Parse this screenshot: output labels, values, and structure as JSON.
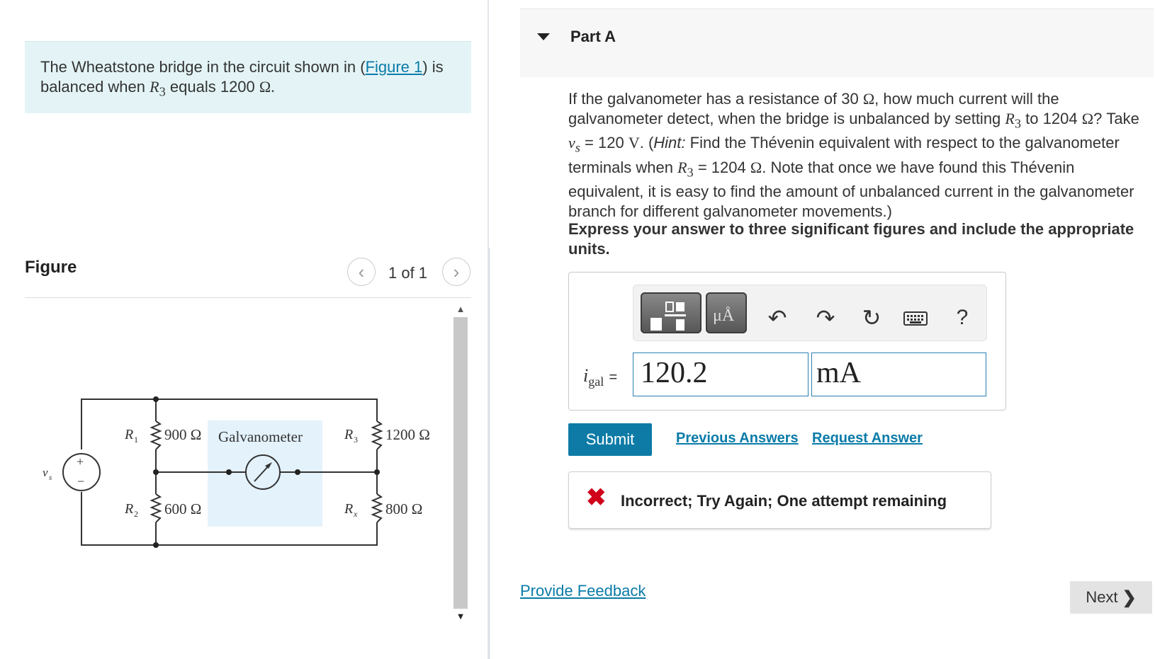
{
  "intro": {
    "text_before_link": "The Wheatstone bridge in the circuit shown in (",
    "link": "Figure 1",
    "text_after_link": ") is balanced when",
    "r3_symbol": "R",
    "r3_sub": "3",
    "text_equals": "equals 1200",
    "ohm": "Ω."
  },
  "figure": {
    "heading": "Figure",
    "counter": "1 of 1",
    "prev_icon": "‹",
    "next_icon": "›",
    "circuit": {
      "source_label": "v",
      "source_sub": "s",
      "plus": "+",
      "minus": "−",
      "r1_label": "R",
      "r1_sub": "1",
      "r1_value": "900 Ω",
      "r2_label": "R",
      "r2_sub": "2",
      "r2_value": "600 Ω",
      "r3_label": "R",
      "r3_sub": "3",
      "r3_value": "1200 Ω",
      "rx_label": "R",
      "rx_sub": "x",
      "rx_value": "800 Ω",
      "galvanometer": "Galvanometer"
    }
  },
  "part": {
    "title": "Part A",
    "question": {
      "p1": "If the galvanometer has a resistance of 30",
      "ohm": "Ω",
      "p2": ", how much current will the galvanometer detect, when the bridge is unbalanced by setting",
      "r3": "R",
      "r3_sub": "3",
      "p3": "to 1204",
      "ohm2": "Ω",
      "p4": "? Take",
      "vs": "v",
      "vs_sub": "s",
      "p5": "= 120",
      "volt": "V",
      "p6": ". (",
      "hint": "Hint:",
      "p7": "Find the Thévenin  equivalent with respect to the galvanometer terminals when",
      "r3b": "R",
      "r3b_sub": "3",
      "p8": "= 1204",
      "ohm3": "Ω",
      "p9": ". Note that once we have found this Thévenin equivalent, it is easy to find the amount of unbalanced current in the galvanometer branch for different galvanometer movements.)"
    },
    "instructions": "Express your answer to three significant figures and include the appropriate units.",
    "answer": {
      "label": "i",
      "label_sub": "gal",
      "equals": "=",
      "value": "120.2",
      "units": "mA"
    },
    "toolbar": {
      "units_glyph": "μÅ",
      "undo": "↶",
      "redo": "↷",
      "reset": "↻",
      "help": "?"
    },
    "submit": "Submit",
    "previous_answers": "Previous Answers",
    "request_answer": "Request Answer",
    "feedback": {
      "mark": "✖",
      "text": "Incorrect; Try Again; One attempt remaining"
    }
  },
  "footer": {
    "provide_feedback": "Provide Feedback",
    "next": "Next",
    "next_icon": "❯"
  },
  "colors": {
    "accent": "#0d7ba6",
    "intro_bg": "#e4f4f6",
    "error": "#d0021b",
    "galvanometer_bg": "#e3f2fb"
  }
}
